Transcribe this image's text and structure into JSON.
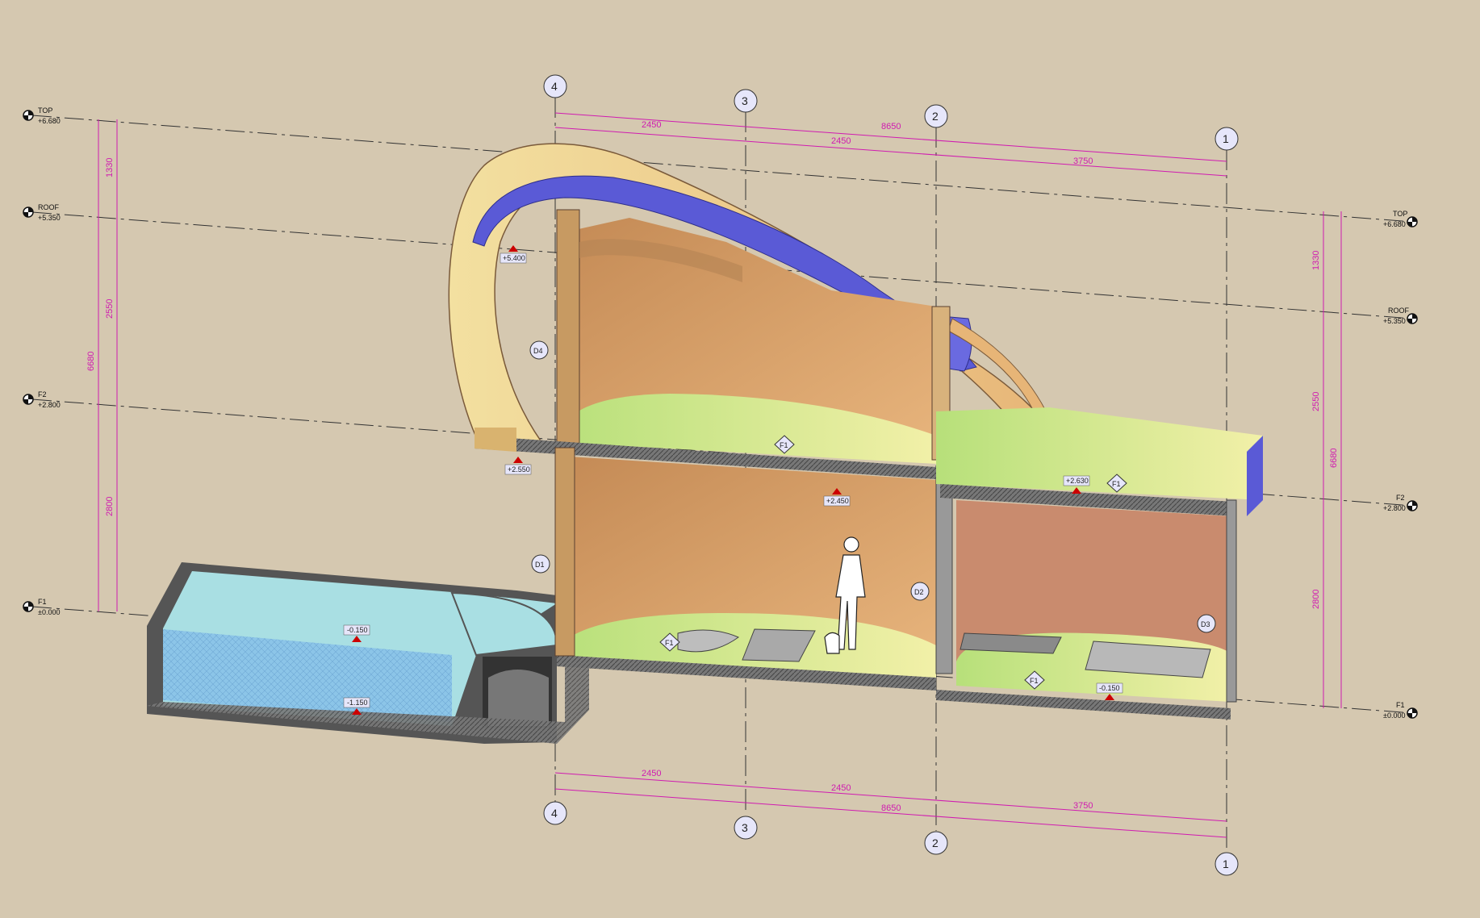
{
  "levels_left": [
    {
      "name": "TOP",
      "value": "+6.680"
    },
    {
      "name": "ROOF",
      "value": "+5.350"
    },
    {
      "name": "F2",
      "value": "+2.800"
    },
    {
      "name": "F1",
      "value": "±0.000"
    }
  ],
  "levels_right": [
    {
      "name": "TOP",
      "value": "+6.680"
    },
    {
      "name": "ROOF",
      "value": "+5.350"
    },
    {
      "name": "F2",
      "value": "+2.800"
    },
    {
      "name": "F1",
      "value": "±0.000"
    }
  ],
  "grid_labels": {
    "g4": "4",
    "g3": "3",
    "g2": "2",
    "g1": "1"
  },
  "dims_top": {
    "d1": "2450",
    "d2": "2450",
    "d3": "3750",
    "total": "8650"
  },
  "dims_bottom": {
    "d1": "2450",
    "d2": "2450",
    "d3": "3750",
    "total": "8650"
  },
  "dims_left": {
    "top": "1330",
    "mid": "2550",
    "low": "2800",
    "total": "6680"
  },
  "dims_right": {
    "top": "1330",
    "mid": "2550",
    "low": "2800",
    "total": "6680"
  },
  "elevations": {
    "e1": "+5.400",
    "e2": "+2.550",
    "e3": "+2.450",
    "e4": "+2.630",
    "e5": "-0.150",
    "e6": "-1.150",
    "e7": "-0.150"
  },
  "tags": {
    "d4": "D4",
    "d1": "D1",
    "d2": "D2",
    "d3": "D3",
    "f1a": "F1",
    "f1b": "F1",
    "f1c": "F1",
    "f1d": "F1"
  },
  "colors": {
    "background": "#d5c8b0",
    "dimension": "#d01bb0",
    "wall": "#d9a06a",
    "floor": "#cfe98a",
    "roof_membrane": "#5a5ad6",
    "pool": "#a9dfe3"
  }
}
